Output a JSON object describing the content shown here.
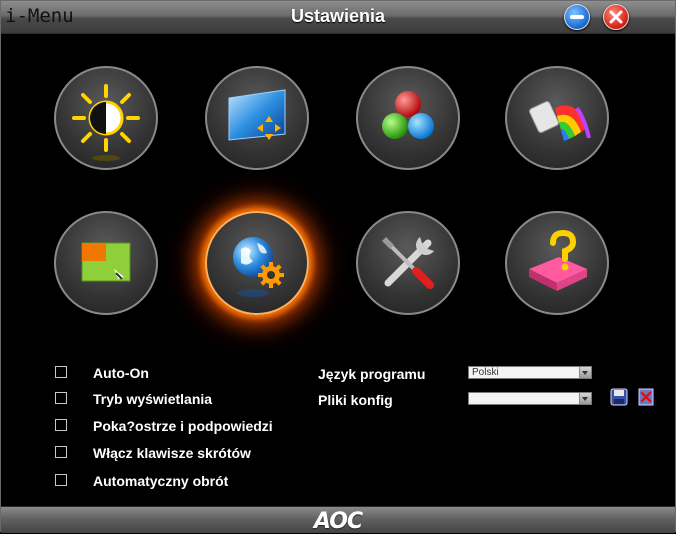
{
  "window": {
    "brand": "i-Menu",
    "title": "Ustawienia",
    "footer_logo": "AOC"
  },
  "icons": [
    {
      "name": "luminance",
      "active": false
    },
    {
      "name": "image-setup",
      "active": false
    },
    {
      "name": "color-setup",
      "active": false
    },
    {
      "name": "picture-boost",
      "active": false
    },
    {
      "name": "osd-setup",
      "active": false
    },
    {
      "name": "settings",
      "active": true
    },
    {
      "name": "extra",
      "active": false
    },
    {
      "name": "exit",
      "active": false
    }
  ],
  "options": [
    {
      "label": "Auto-On",
      "checked": false
    },
    {
      "label": "Tryb wyświetlania",
      "checked": false
    },
    {
      "label": "Poka?ostrze i podpowiedzi",
      "checked": false
    },
    {
      "label": "Włącz klawisze skrótów",
      "checked": false
    },
    {
      "label": "Automatyczny obrót",
      "checked": false
    }
  ],
  "language": {
    "label": "Język programu",
    "value": "Polski"
  },
  "config": {
    "label": "Pliki konfig",
    "value": ""
  },
  "colors": {
    "active_glow": "#ff7a00",
    "title_text": "#ffffff"
  }
}
